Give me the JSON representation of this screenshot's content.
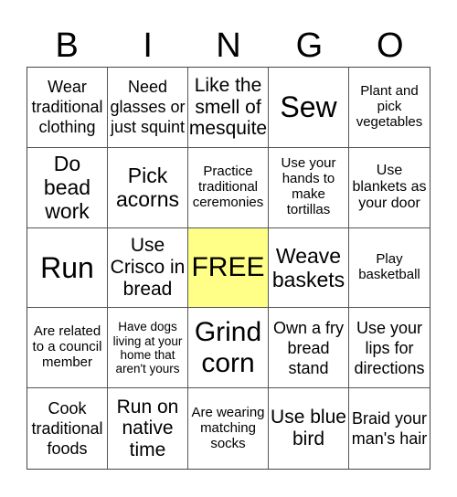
{
  "header": {
    "letters": [
      "B",
      "I",
      "N",
      "G",
      "O"
    ]
  },
  "free_color": "#FFFF88",
  "cells": [
    "Wear traditional clothing",
    "Need glasses or just squint",
    "Like the smell of mesquite",
    "Sew",
    "Plant and pick vegetables",
    "Do bead work",
    "Pick acorns",
    "Practice traditional ceremonies",
    "Use your hands to make tortillas",
    "Use blankets as your door",
    "Run",
    "Use Crisco in bread",
    "FREE",
    "Weave baskets",
    "Play basketball",
    "Are related to a council member",
    "Have dogs living at your home that aren't yours",
    "Grind corn",
    "Own a fry bread stand",
    "Use your lips for directions",
    "Cook traditional foods",
    "Run on native time",
    "Are wearing matching socks",
    "Use blue bird",
    "Braid your man's hair"
  ]
}
